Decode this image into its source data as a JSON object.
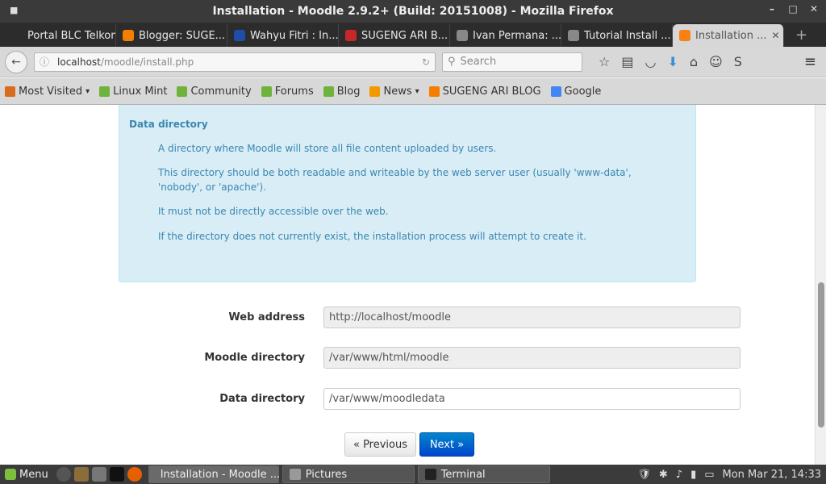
{
  "window": {
    "title": "Installation - Moodle 2.9.2+ (Build: 20151008) - Mozilla Firefox",
    "controls": [
      "–",
      "□",
      "✕"
    ]
  },
  "tabs": [
    {
      "label": "Portal BLC Telkom ...",
      "color": "#2c2c2c"
    },
    {
      "label": "Blogger: SUGE...",
      "color": "#f57d00"
    },
    {
      "label": "Wahyu Fitri : In...",
      "color": "#1e4ea8"
    },
    {
      "label": "SUGENG ARI B...",
      "color": "#c62828"
    },
    {
      "label": "Ivan Permana: ...",
      "color": "#888"
    },
    {
      "label": "Tutorial Install ...",
      "color": "#888"
    },
    {
      "label": "Installation ...",
      "color": "#f98012",
      "active": true
    }
  ],
  "navbar": {
    "url_host": "localhost",
    "url_path": "/moodle/install.php",
    "search_placeholder": "Search"
  },
  "bookmarks": [
    {
      "label": "Most Visited",
      "color": "#d96b1c",
      "dropdown": true
    },
    {
      "label": "Linux Mint",
      "color": "#6fb33d"
    },
    {
      "label": "Community",
      "color": "#6fb33d"
    },
    {
      "label": "Forums",
      "color": "#6fb33d"
    },
    {
      "label": "Blog",
      "color": "#6fb33d"
    },
    {
      "label": "News",
      "color": "#f29900",
      "dropdown": true
    },
    {
      "label": "SUGENG ARI BLOG",
      "color": "#f57d00"
    },
    {
      "label": "Google",
      "color": "#4285f4"
    }
  ],
  "info": {
    "heading": "Data directory",
    "p1": "A directory where Moodle will store all file content uploaded by users.",
    "p2": "This directory should be both readable and writeable by the web server user (usually 'www-data', 'nobody', or 'apache').",
    "p3": "It must not be directly accessible over the web.",
    "p4": "If the directory does not currently exist, the installation process will attempt to create it."
  },
  "form": {
    "web_address_label": "Web address",
    "web_address_value": "http://localhost/moodle",
    "moodle_dir_label": "Moodle directory",
    "moodle_dir_value": "/var/www/html/moodle",
    "data_dir_label": "Data directory",
    "data_dir_value": "/var/www/moodledata",
    "prev_label": "« Previous",
    "next_label": "Next »"
  },
  "taskbar": {
    "menu_label": "Menu",
    "tasks": [
      {
        "label": "Installation - Moodle ...",
        "color": "#f98012"
      },
      {
        "label": "Pictures",
        "color": "#999"
      },
      {
        "label": "Terminal",
        "color": "#222"
      }
    ],
    "clock": "Mon Mar 21, 14:33"
  }
}
